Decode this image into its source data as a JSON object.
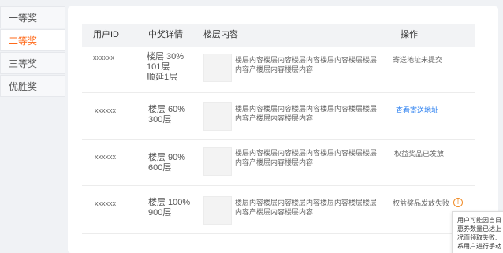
{
  "sidebar": {
    "items": [
      {
        "label": "一等奖"
      },
      {
        "label": "二等奖"
      },
      {
        "label": "三等奖"
      },
      {
        "label": "优胜奖"
      }
    ],
    "active_index": 1,
    "active_color": "#ff6a1a"
  },
  "table": {
    "headers": [
      "用户ID",
      "中奖详情",
      "楼层内容",
      "操作"
    ],
    "rows": [
      {
        "user_id": "xxxxxx",
        "detail": [
          "楼层 30%",
          "101层",
          "顺延1层"
        ],
        "content": "楼层内容楼层内容楼层内容楼层内容楼层楼层内容产楼层内容楼层内容",
        "operation": "寄送地址未提交",
        "operation_is_link": false
      },
      {
        "user_id": "xxxxxx",
        "detail": [
          "楼层 60%",
          "300层"
        ],
        "content": "楼层内容楼层内容楼层内容楼层内容楼层楼层内容产楼层内容楼层内容",
        "operation": "查看寄送地址",
        "operation_is_link": true
      },
      {
        "user_id": "xxxxxx",
        "detail": [
          "楼层 90%",
          "600层"
        ],
        "content": "楼层内容楼层内容楼层内容楼层内容楼层楼层内容产楼层内容楼层内容",
        "operation": "权益奖品已发放",
        "operation_is_link": false
      },
      {
        "user_id": "xxxxxx",
        "detail": [
          "楼层 100%",
          "900层"
        ],
        "content": "楼层内容楼层内容楼层内容楼层内容楼层楼层内容产楼层内容楼层内容",
        "operation": "权益奖品发放失败",
        "operation_is_link": false,
        "warn_icon": "info-icon"
      }
    ]
  },
  "tooltip": {
    "lines": [
      "用户可能因当日",
      "惠券数量已达上",
      "况而领取失败,",
      "系用户进行手动"
    ]
  },
  "colors": {
    "link": "#2a7ff0",
    "warning": "#f08a24"
  }
}
